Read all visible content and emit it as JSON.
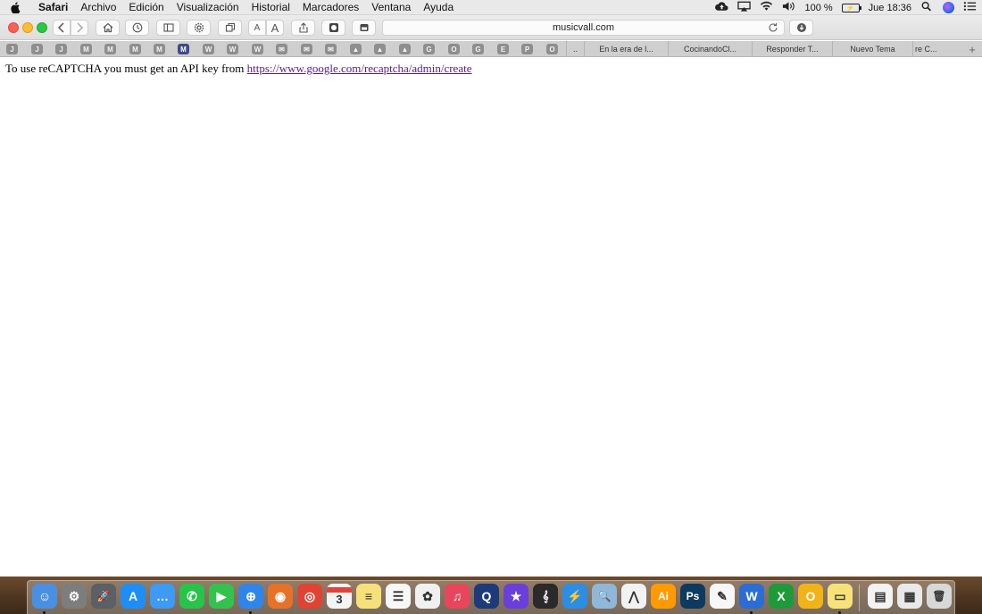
{
  "menubar": {
    "app_name": "Safari",
    "items": [
      "Archivo",
      "Edición",
      "Visualización",
      "Historial",
      "Marcadores",
      "Ventana",
      "Ayuda"
    ],
    "battery_percent": "100 %",
    "clock": "Jue 18:36"
  },
  "toolbar": {
    "url": "musicvall.com",
    "font_small": "A",
    "font_large": "A"
  },
  "tabs": {
    "pinned": [
      "J",
      "J",
      "J",
      "M",
      "M",
      "M",
      "M",
      "M",
      "W",
      "W",
      "W",
      "✉",
      "✉",
      "✉",
      "▲",
      "▲",
      "▲",
      "G",
      "O",
      "G",
      "E",
      "P",
      "O"
    ],
    "active_pinned_index": 7,
    "open": [
      "..",
      "En la era de l...",
      "CocinandoCl...",
      "Responder T...",
      "Nuevo Tema",
      "re C..."
    ],
    "new_tab": "+"
  },
  "page": {
    "message": "To use reCAPTCHA you must get an API key from ",
    "link": "https://www.google.com/recaptcha/admin/create"
  },
  "dock": {
    "calendar_day": "3",
    "apps": [
      {
        "name": "finder-icon",
        "color": "#4a90e2",
        "glyph": "☺"
      },
      {
        "name": "system-preferences-icon",
        "color": "#7d7d7d",
        "glyph": "⚙"
      },
      {
        "name": "launchpad-icon",
        "color": "#5b5f66",
        "glyph": "🚀"
      },
      {
        "name": "app-store-icon",
        "color": "#1e8ef5",
        "glyph": "A"
      },
      {
        "name": "messages-bubble-icon",
        "color": "#3d9af5",
        "glyph": "…"
      },
      {
        "name": "whatsapp-icon",
        "color": "#27c34a",
        "glyph": "✆"
      },
      {
        "name": "facetime-icon",
        "color": "#33c24d",
        "glyph": "▶"
      },
      {
        "name": "safari-icon",
        "color": "#2f86e8",
        "glyph": "⊕"
      },
      {
        "name": "firefox-icon",
        "color": "#e8712a",
        "glyph": "◉"
      },
      {
        "name": "chrome-icon",
        "color": "#e04334",
        "glyph": "◎"
      },
      {
        "name": "calendar-icon",
        "color": "#f4f4f4",
        "glyph": "3"
      },
      {
        "name": "notes-icon",
        "color": "#f5e07a",
        "glyph": "≡"
      },
      {
        "name": "reminders-icon",
        "color": "#f7f7f7",
        "glyph": "☰"
      },
      {
        "name": "photos-icon",
        "color": "#f0f0f0",
        "glyph": "✿"
      },
      {
        "name": "itunes-icon",
        "color": "#e8465d",
        "glyph": "♫"
      },
      {
        "name": "quicktime-icon",
        "color": "#1c3b78",
        "glyph": "Q"
      },
      {
        "name": "imovie-icon",
        "color": "#6a3fd9",
        "glyph": "★"
      },
      {
        "name": "garageband-icon",
        "color": "#2a2a2a",
        "glyph": "𝄞"
      },
      {
        "name": "network-utility-icon",
        "color": "#2b8ee6",
        "glyph": "⚡"
      },
      {
        "name": "preview-icon",
        "color": "#8fb7d9",
        "glyph": "🔍"
      },
      {
        "name": "acrobat-icon",
        "color": "#f2f2f2",
        "glyph": "⋀"
      },
      {
        "name": "illustrator-icon",
        "color": "#ff9a00",
        "glyph": "Ai"
      },
      {
        "name": "photoshop-icon",
        "color": "#0d3a5e",
        "glyph": "Ps"
      },
      {
        "name": "textedit-icon",
        "color": "#f7f7f7",
        "glyph": "✎"
      },
      {
        "name": "word-icon",
        "color": "#2b6dd3",
        "glyph": "W"
      },
      {
        "name": "excel-icon",
        "color": "#1f9a3a",
        "glyph": "X"
      },
      {
        "name": "outlook-icon",
        "color": "#f0b419",
        "glyph": "O"
      },
      {
        "name": "stickies-icon",
        "color": "#f7e27a",
        "glyph": "▭"
      },
      {
        "name": "documents-icon",
        "color": "#f3f3f3",
        "glyph": "▤"
      },
      {
        "name": "downloads-stack-icon",
        "color": "#e9e9e9",
        "glyph": "▦"
      },
      {
        "name": "trash-icon",
        "color": "#d8d8d8",
        "glyph": "🗑"
      }
    ]
  }
}
